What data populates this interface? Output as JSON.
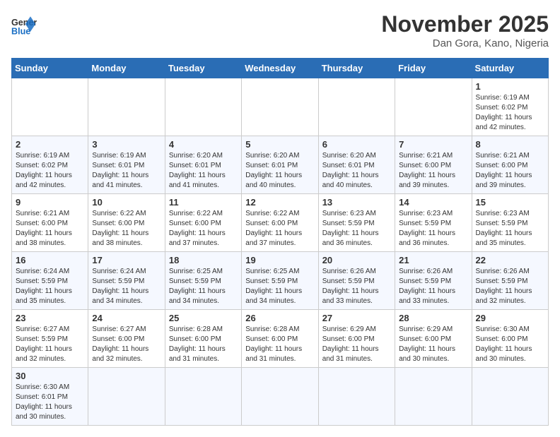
{
  "header": {
    "logo_general": "General",
    "logo_blue": "Blue",
    "month": "November 2025",
    "location": "Dan Gora, Kano, Nigeria"
  },
  "days_of_week": [
    "Sunday",
    "Monday",
    "Tuesday",
    "Wednesday",
    "Thursday",
    "Friday",
    "Saturday"
  ],
  "weeks": [
    [
      {
        "day": "",
        "info": ""
      },
      {
        "day": "",
        "info": ""
      },
      {
        "day": "",
        "info": ""
      },
      {
        "day": "",
        "info": ""
      },
      {
        "day": "",
        "info": ""
      },
      {
        "day": "",
        "info": ""
      },
      {
        "day": "1",
        "info": "Sunrise: 6:19 AM\nSunset: 6:02 PM\nDaylight: 11 hours and 42 minutes."
      }
    ],
    [
      {
        "day": "2",
        "info": "Sunrise: 6:19 AM\nSunset: 6:02 PM\nDaylight: 11 hours and 42 minutes."
      },
      {
        "day": "3",
        "info": "Sunrise: 6:19 AM\nSunset: 6:01 PM\nDaylight: 11 hours and 41 minutes."
      },
      {
        "day": "4",
        "info": "Sunrise: 6:20 AM\nSunset: 6:01 PM\nDaylight: 11 hours and 41 minutes."
      },
      {
        "day": "5",
        "info": "Sunrise: 6:20 AM\nSunset: 6:01 PM\nDaylight: 11 hours and 40 minutes."
      },
      {
        "day": "6",
        "info": "Sunrise: 6:20 AM\nSunset: 6:01 PM\nDaylight: 11 hours and 40 minutes."
      },
      {
        "day": "7",
        "info": "Sunrise: 6:21 AM\nSunset: 6:00 PM\nDaylight: 11 hours and 39 minutes."
      },
      {
        "day": "8",
        "info": "Sunrise: 6:21 AM\nSunset: 6:00 PM\nDaylight: 11 hours and 39 minutes."
      }
    ],
    [
      {
        "day": "9",
        "info": "Sunrise: 6:21 AM\nSunset: 6:00 PM\nDaylight: 11 hours and 38 minutes."
      },
      {
        "day": "10",
        "info": "Sunrise: 6:22 AM\nSunset: 6:00 PM\nDaylight: 11 hours and 38 minutes."
      },
      {
        "day": "11",
        "info": "Sunrise: 6:22 AM\nSunset: 6:00 PM\nDaylight: 11 hours and 37 minutes."
      },
      {
        "day": "12",
        "info": "Sunrise: 6:22 AM\nSunset: 6:00 PM\nDaylight: 11 hours and 37 minutes."
      },
      {
        "day": "13",
        "info": "Sunrise: 6:23 AM\nSunset: 5:59 PM\nDaylight: 11 hours and 36 minutes."
      },
      {
        "day": "14",
        "info": "Sunrise: 6:23 AM\nSunset: 5:59 PM\nDaylight: 11 hours and 36 minutes."
      },
      {
        "day": "15",
        "info": "Sunrise: 6:23 AM\nSunset: 5:59 PM\nDaylight: 11 hours and 35 minutes."
      }
    ],
    [
      {
        "day": "16",
        "info": "Sunrise: 6:24 AM\nSunset: 5:59 PM\nDaylight: 11 hours and 35 minutes."
      },
      {
        "day": "17",
        "info": "Sunrise: 6:24 AM\nSunset: 5:59 PM\nDaylight: 11 hours and 34 minutes."
      },
      {
        "day": "18",
        "info": "Sunrise: 6:25 AM\nSunset: 5:59 PM\nDaylight: 11 hours and 34 minutes."
      },
      {
        "day": "19",
        "info": "Sunrise: 6:25 AM\nSunset: 5:59 PM\nDaylight: 11 hours and 34 minutes."
      },
      {
        "day": "20",
        "info": "Sunrise: 6:26 AM\nSunset: 5:59 PM\nDaylight: 11 hours and 33 minutes."
      },
      {
        "day": "21",
        "info": "Sunrise: 6:26 AM\nSunset: 5:59 PM\nDaylight: 11 hours and 33 minutes."
      },
      {
        "day": "22",
        "info": "Sunrise: 6:26 AM\nSunset: 5:59 PM\nDaylight: 11 hours and 32 minutes."
      }
    ],
    [
      {
        "day": "23",
        "info": "Sunrise: 6:27 AM\nSunset: 5:59 PM\nDaylight: 11 hours and 32 minutes."
      },
      {
        "day": "24",
        "info": "Sunrise: 6:27 AM\nSunset: 6:00 PM\nDaylight: 11 hours and 32 minutes."
      },
      {
        "day": "25",
        "info": "Sunrise: 6:28 AM\nSunset: 6:00 PM\nDaylight: 11 hours and 31 minutes."
      },
      {
        "day": "26",
        "info": "Sunrise: 6:28 AM\nSunset: 6:00 PM\nDaylight: 11 hours and 31 minutes."
      },
      {
        "day": "27",
        "info": "Sunrise: 6:29 AM\nSunset: 6:00 PM\nDaylight: 11 hours and 31 minutes."
      },
      {
        "day": "28",
        "info": "Sunrise: 6:29 AM\nSunset: 6:00 PM\nDaylight: 11 hours and 30 minutes."
      },
      {
        "day": "29",
        "info": "Sunrise: 6:30 AM\nSunset: 6:00 PM\nDaylight: 11 hours and 30 minutes."
      }
    ],
    [
      {
        "day": "30",
        "info": "Sunrise: 6:30 AM\nSunset: 6:01 PM\nDaylight: 11 hours and 30 minutes."
      },
      {
        "day": "",
        "info": ""
      },
      {
        "day": "",
        "info": ""
      },
      {
        "day": "",
        "info": ""
      },
      {
        "day": "",
        "info": ""
      },
      {
        "day": "",
        "info": ""
      },
      {
        "day": "",
        "info": ""
      }
    ]
  ]
}
